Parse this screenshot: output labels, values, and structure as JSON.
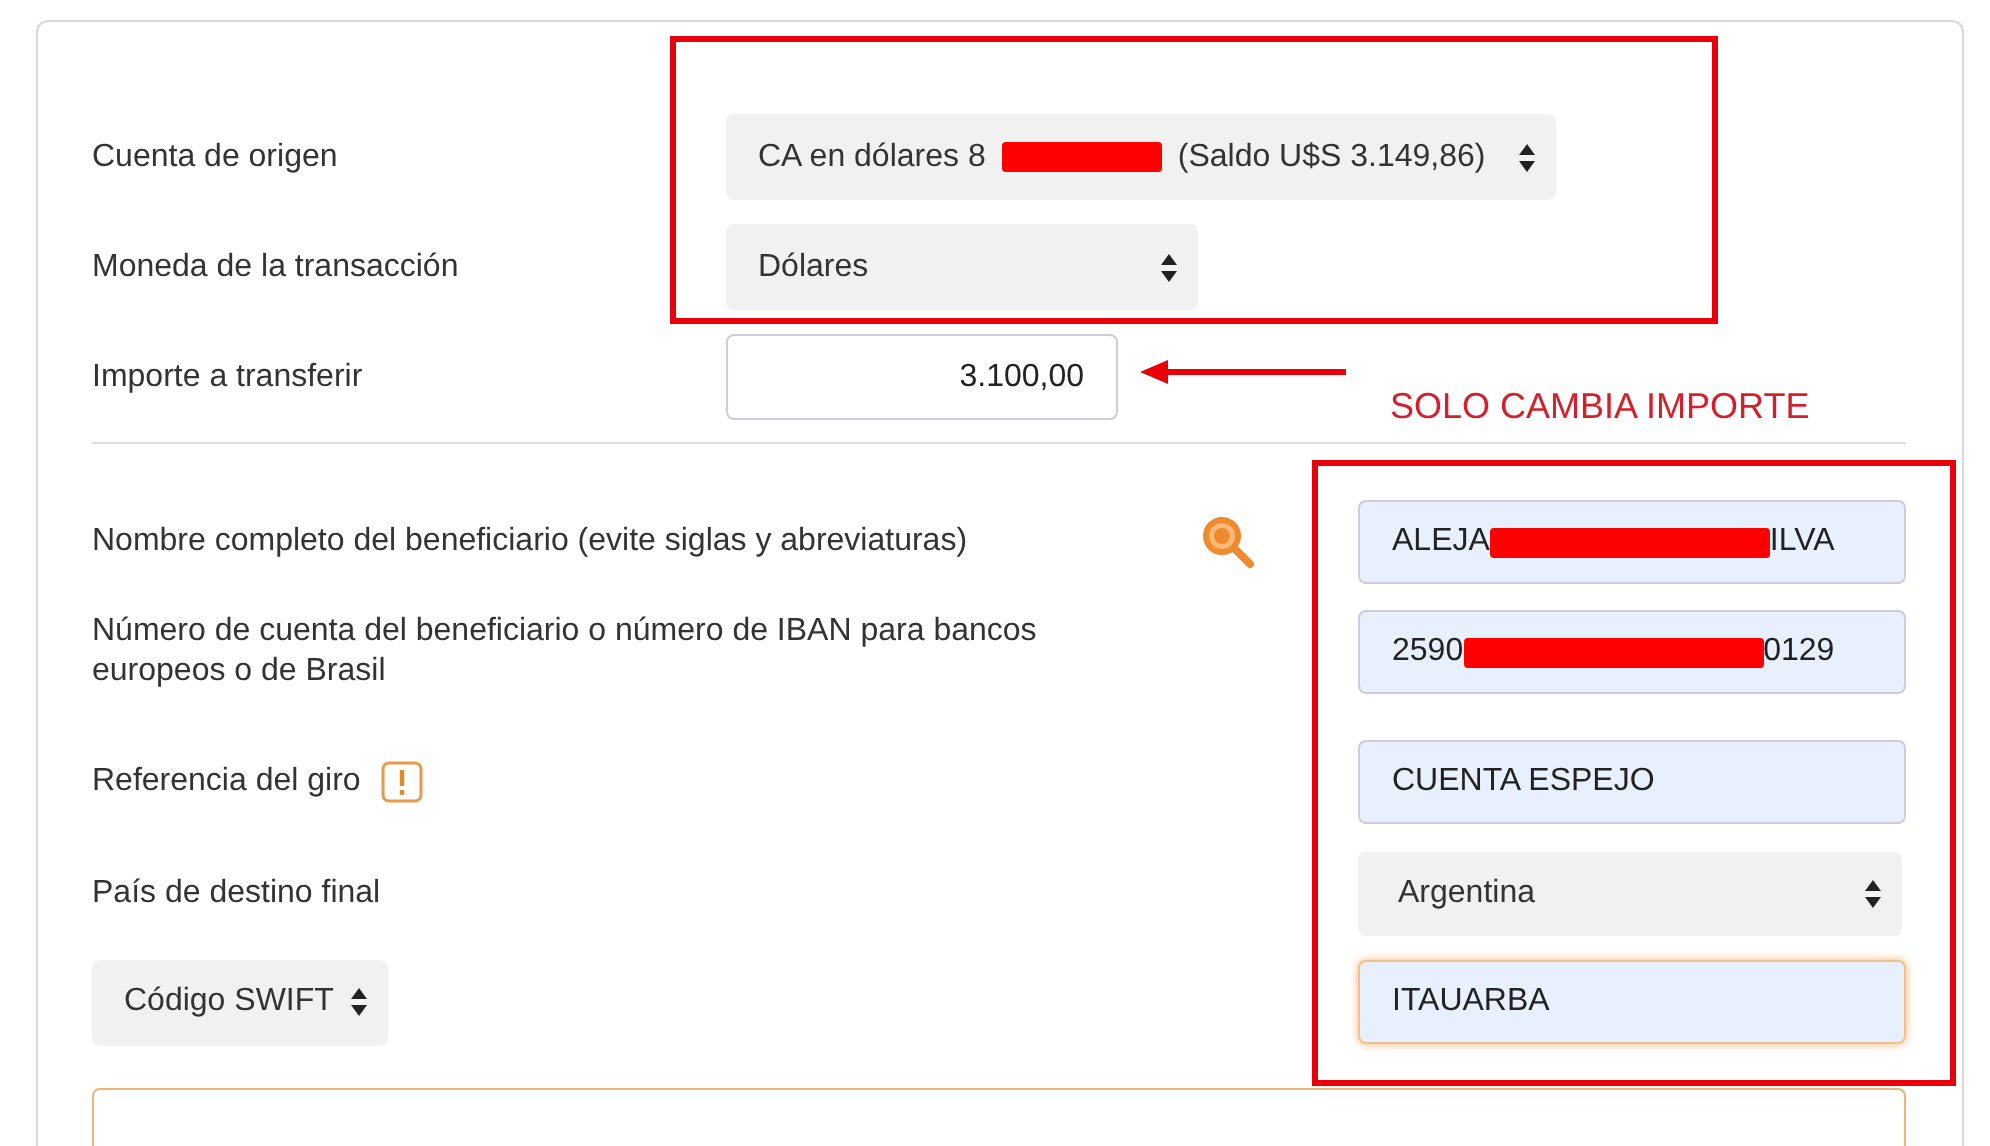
{
  "transfer": [
    {
      "label": "Cuenta de origen",
      "kind": "select",
      "value_before": "CA en dólares 8",
      "redacted": true,
      "value_after": "(Saldo U$S 3.149,86)"
    },
    {
      "label": "Moneda de la transacción",
      "kind": "select",
      "value_before": "Dólares",
      "redacted": false
    },
    {
      "label": "Importe a transferir",
      "kind": "amount",
      "value_before": "3.100,00",
      "redacted": false
    }
  ],
  "beneficiary": [
    {
      "label": "Nombre completo del beneficiario (evite siglas y abreviaturas)",
      "kind": "input",
      "value_before": "ALEJA",
      "redacted": true,
      "value_after": "ILVA",
      "focused": false
    },
    {
      "label": "Número de cuenta del beneficiario o número de IBAN para bancos europeos o de Brasil",
      "kind": "input",
      "value_before": "2590",
      "redacted": true,
      "value_after": "0129",
      "focused": false
    },
    {
      "label": "Referencia del giro",
      "kind": "input",
      "value_before": "CUENTA ESPEJO",
      "redacted": false,
      "focused": false
    },
    {
      "label": "País de destino final",
      "kind": "select",
      "value_before": "Argentina",
      "redacted": false
    },
    {
      "label": "Código SWIFT",
      "kind": "label-select",
      "value_before": "ITAUARBA",
      "redacted": false,
      "focused": true
    }
  ],
  "annotations": [
    {
      "kind": "box"
    },
    {
      "kind": "arrow"
    },
    {
      "kind": "note",
      "text": "SOLO CAMBIA IMPORTE"
    },
    {
      "kind": "box"
    }
  ]
}
